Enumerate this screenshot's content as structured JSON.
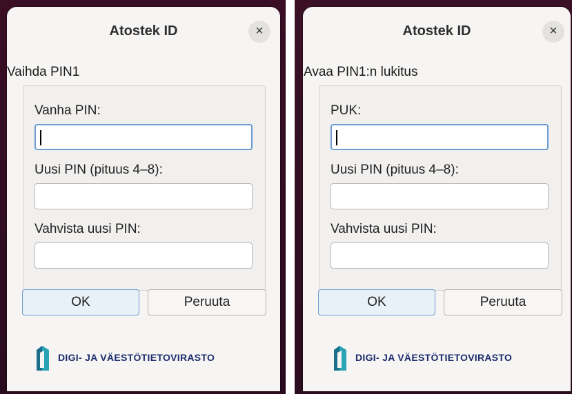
{
  "colors": {
    "accent": "#6b9dcf",
    "logo_teal": "#1e8ea0",
    "logo_text": "#1b2a6b"
  },
  "dialogs": [
    {
      "title": "Atostek ID",
      "close_icon": "×",
      "heading": "Vaihda PIN1",
      "fields": [
        {
          "label": "Vanha PIN:",
          "value": ""
        },
        {
          "label": "Uusi PIN (pituus 4–8):",
          "value": ""
        },
        {
          "label": "Vahvista uusi PIN:",
          "value": ""
        }
      ],
      "ok_label": "OK",
      "cancel_label": "Peruuta",
      "logo_text": "DIGI- JA VÄESTÖTIETOVIRASTO"
    },
    {
      "title": "Atostek ID",
      "close_icon": "×",
      "heading": "Avaa PIN1:n lukitus",
      "fields": [
        {
          "label": "PUK:",
          "value": ""
        },
        {
          "label": "Uusi PIN (pituus 4–8):",
          "value": ""
        },
        {
          "label": "Vahvista uusi PIN:",
          "value": ""
        }
      ],
      "ok_label": "OK",
      "cancel_label": "Peruuta",
      "logo_text": "DIGI- JA VÄESTÖTIETOVIRASTO"
    }
  ]
}
